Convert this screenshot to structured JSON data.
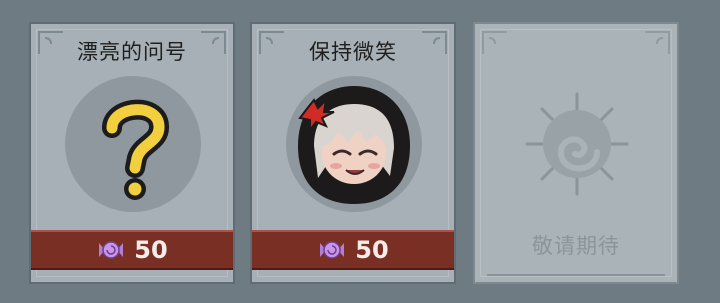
{
  "cards": [
    {
      "title": "漂亮的问号",
      "price": "50",
      "icon": "question-mark-icon"
    },
    {
      "title": "保持微笑",
      "price": "50",
      "icon": "smiling-girl-avatar"
    },
    {
      "title": "",
      "price": "",
      "icon": "locked-swirl-emblem-icon",
      "status": "敬请期待"
    }
  ],
  "currency_icon": "candy-icon",
  "colors": {
    "price_bar": "#7a2f25",
    "card": "#a6b0b6",
    "question_mark": "#f2cf3f"
  }
}
